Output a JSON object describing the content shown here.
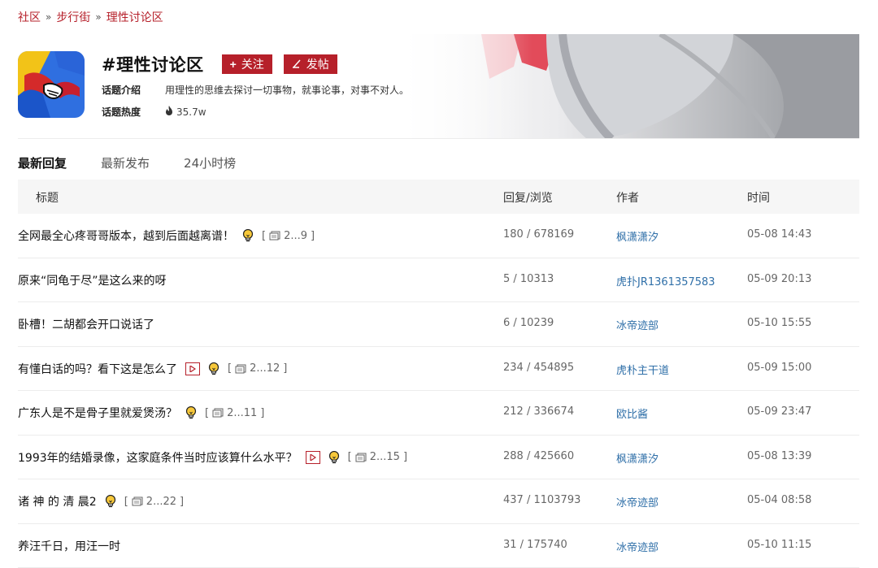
{
  "breadcrumb": {
    "items": [
      "社区",
      "步行街",
      "理性讨论区"
    ],
    "sep": "»"
  },
  "topic": {
    "title": "#理性讨论区",
    "follow_label": "关注",
    "post_label": "发帖",
    "intro_label": "话题介绍",
    "intro_text": "用理性的思维去探讨一切事物，就事论事，对事不对人。",
    "heat_label": "话题热度",
    "heat_value": "35.7w"
  },
  "tabs": [
    "最新回复",
    "最新发布",
    "24小时榜"
  ],
  "table": {
    "headers": {
      "title": "标题",
      "stats": "回复/浏览",
      "author": "作者",
      "time": "时间"
    },
    "rows": [
      {
        "title": "全网最全心疼哥哥版本，越到后面越离谱！",
        "video": false,
        "bulb": true,
        "pages": "2...9",
        "stats": "180 / 678169",
        "author": "枫潇潇汐",
        "time": "05-08 14:43"
      },
      {
        "title": "原来“同龟于尽”是这么来的呀",
        "video": false,
        "bulb": false,
        "pages": "",
        "stats": "5 / 10313",
        "author": "虎扑JR1361357583",
        "time": "05-09 20:13"
      },
      {
        "title": "卧槽！二胡都会开口说话了",
        "video": false,
        "bulb": false,
        "pages": "",
        "stats": "6 / 10239",
        "author": "冰帝迹部",
        "time": "05-10 15:55"
      },
      {
        "title": "有懂白话的吗？看下这是怎么了",
        "video": true,
        "bulb": true,
        "pages": "2...12",
        "stats": "234 / 454895",
        "author": "虎朴主干道",
        "time": "05-09 15:00"
      },
      {
        "title": "广东人是不是骨子里就爱煲汤？",
        "video": false,
        "bulb": true,
        "pages": "2...11",
        "stats": "212 / 336674",
        "author": "欧比酱",
        "time": "05-09 23:47"
      },
      {
        "title": "1993年的结婚录像，这家庭条件当时应该算什么水平？",
        "video": true,
        "bulb": true,
        "pages": "2...15",
        "stats": "288 / 425660",
        "author": "枫潇潇汐",
        "time": "05-08 13:39"
      },
      {
        "title": "诸 神 的 清 晨2",
        "video": false,
        "bulb": true,
        "pages": "2...22",
        "stats": "437 / 1103793",
        "author": "冰帝迹部",
        "time": "05-04 08:58"
      },
      {
        "title": "养汪千日，用汪一时",
        "video": false,
        "bulb": false,
        "pages": "",
        "stats": "31 / 175740",
        "author": "冰帝迹部",
        "time": "05-10 11:15"
      }
    ]
  },
  "colors": {
    "accent": "#b6202a",
    "link": "#2f6fa8"
  }
}
